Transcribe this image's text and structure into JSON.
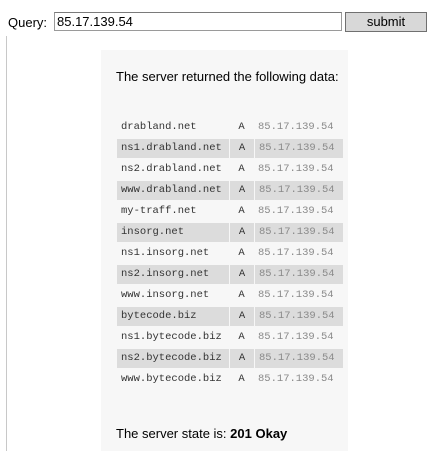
{
  "query": {
    "label": "Query:",
    "value": "85.17.139.54",
    "submit_label": "submit"
  },
  "result": {
    "heading": "The server returned the following data:",
    "records": [
      {
        "host": "drabland.net",
        "type": "A",
        "ip": "85.17.139.54"
      },
      {
        "host": "ns1.drabland.net",
        "type": "A",
        "ip": "85.17.139.54"
      },
      {
        "host": "ns2.drabland.net",
        "type": "A",
        "ip": "85.17.139.54"
      },
      {
        "host": "www.drabland.net",
        "type": "A",
        "ip": "85.17.139.54"
      },
      {
        "host": "my-traff.net",
        "type": "A",
        "ip": "85.17.139.54"
      },
      {
        "host": "insorg.net",
        "type": "A",
        "ip": "85.17.139.54"
      },
      {
        "host": "ns1.insorg.net",
        "type": "A",
        "ip": "85.17.139.54"
      },
      {
        "host": "ns2.insorg.net",
        "type": "A",
        "ip": "85.17.139.54"
      },
      {
        "host": "www.insorg.net",
        "type": "A",
        "ip": "85.17.139.54"
      },
      {
        "host": "bytecode.biz",
        "type": "A",
        "ip": "85.17.139.54"
      },
      {
        "host": "ns1.bytecode.biz",
        "type": "A",
        "ip": "85.17.139.54"
      },
      {
        "host": "ns2.bytecode.biz",
        "type": "A",
        "ip": "85.17.139.54"
      },
      {
        "host": "www.bytecode.biz",
        "type": "A",
        "ip": "85.17.139.54"
      }
    ],
    "state_label": "The server state is:",
    "state_value": "201 Okay"
  }
}
